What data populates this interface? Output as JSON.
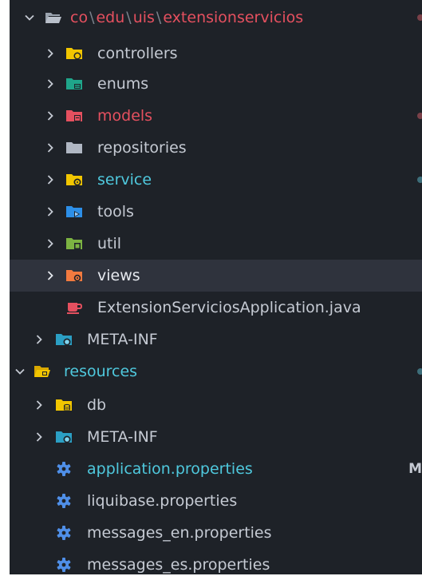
{
  "explorer": {
    "package_path": {
      "segments": [
        "co",
        "edu",
        "uis",
        "extensionservicios"
      ],
      "separator": "\\"
    },
    "items": [
      {
        "label": "controllers",
        "icon": "folder-controller-icon",
        "color": "#f2c600"
      },
      {
        "label": "enums",
        "icon": "folder-enum-icon",
        "color": "#1fa58a"
      },
      {
        "label": "models",
        "icon": "folder-model-icon",
        "color": "#e5505f"
      },
      {
        "label": "repositories",
        "icon": "folder-repository-icon",
        "color": "#b0b7c3"
      },
      {
        "label": "service",
        "icon": "folder-service-icon",
        "color": "#f2c600"
      },
      {
        "label": "tools",
        "icon": "folder-tools-icon",
        "color": "#2d8fe8"
      },
      {
        "label": "util",
        "icon": "folder-util-icon",
        "color": "#7cb342"
      },
      {
        "label": "views",
        "icon": "folder-views-icon",
        "color": "#f27a3f"
      },
      {
        "label": "ExtensionServiciosApplication.java",
        "icon": "java-coffee-icon",
        "color": "#e5505f"
      },
      {
        "label": "META-INF",
        "icon": "folder-meta-icon",
        "color": "#2b9fc4"
      },
      {
        "label": "resources",
        "icon": "folder-resources-open-icon",
        "color": "#f2c600"
      },
      {
        "label": "db",
        "icon": "folder-db-icon",
        "color": "#f2c600"
      },
      {
        "label": "META-INF",
        "icon": "folder-meta-icon",
        "color": "#2b9fc4"
      },
      {
        "label": "application.properties",
        "icon": "properties-gear-icon",
        "color": "#4f8fe8"
      },
      {
        "label": "liquibase.properties",
        "icon": "properties-gear-icon",
        "color": "#4f8fe8"
      },
      {
        "label": "messages_en.properties",
        "icon": "properties-gear-icon",
        "color": "#4f8fe8"
      },
      {
        "label": "messages_es.properties",
        "icon": "properties-gear-icon",
        "color": "#4f8fe8"
      }
    ],
    "application_properties_status": "M",
    "colors": {
      "background": "#1e2228",
      "selected_row": "#2f333d",
      "modified_red": "#e5505f",
      "modified_cyan": "#4fc9de",
      "default_text": "#c5cad3"
    }
  }
}
